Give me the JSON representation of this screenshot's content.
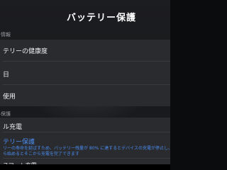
{
  "header": {
    "title": "バッテリー保護"
  },
  "battery_info": {
    "section_label": "ー情報",
    "rows": [
      {
        "label": "テリーの健康度"
      },
      {
        "label": "日"
      },
      {
        "label": "使用"
      }
    ]
  },
  "charging": {
    "section_label": "ル保護",
    "row_label": "ル充電"
  },
  "protection": {
    "title": "テリー保護",
    "line1": "リーの寿命を延ばすため、バッテリー残量が 80% に達するとデバイスの充電が停止し、スタ",
    "line2": "ら始めるとそこから充電を完了できます"
  },
  "smart": {
    "label": "スマート充電"
  },
  "colors": {
    "accent": "#4a8df0",
    "background": "#1a1b1e",
    "group": "#2a2b2f"
  }
}
